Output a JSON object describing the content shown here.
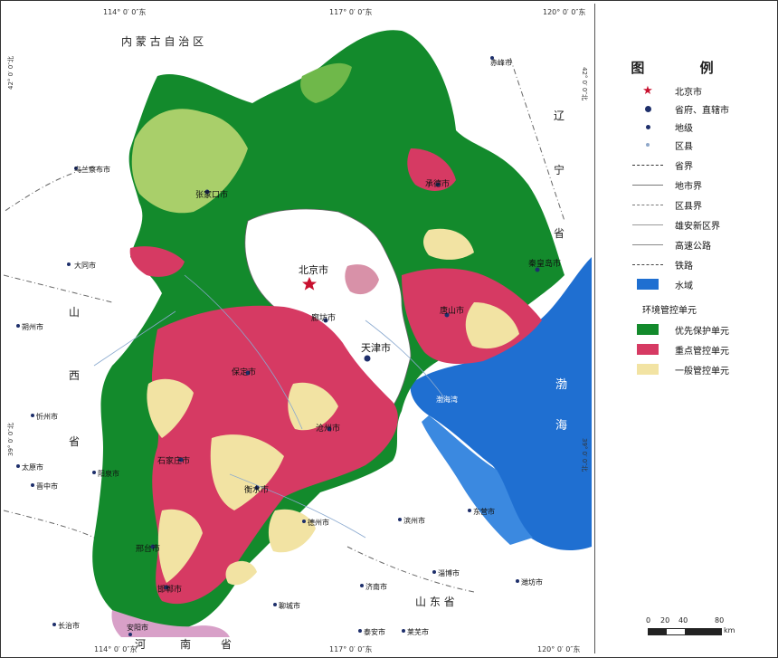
{
  "legend": {
    "title": "图  例",
    "items": [
      {
        "label": "北京市",
        "sym": "star",
        "color": "#c8102e"
      },
      {
        "label": "省府、直辖市",
        "sym": "dot-big",
        "color": "#1e2f6b"
      },
      {
        "label": "地级",
        "sym": "dot",
        "color": "#1e2f6b"
      },
      {
        "label": "区县",
        "sym": "dot-small",
        "color": "#8fa7c9"
      },
      {
        "label": "省界",
        "sym": "dashdot",
        "color": "#333333"
      },
      {
        "label": "地市界",
        "sym": "line-thin",
        "color": "#777777"
      },
      {
        "label": "区县界",
        "sym": "dashdot-thin",
        "color": "#777777"
      },
      {
        "label": "雄安新区界",
        "sym": "line-thin",
        "color": "#999999"
      },
      {
        "label": "高速公路",
        "sym": "line",
        "color": "#888888"
      },
      {
        "label": "铁路",
        "sym": "dashed",
        "color": "#444444"
      },
      {
        "label": "水域",
        "sym": "box",
        "color": "#1f6fd1"
      }
    ],
    "subtitle": "环境管控单元",
    "units": [
      {
        "label": "优先保护单元",
        "color": "#138a2c"
      },
      {
        "label": "重点管控单元",
        "color": "#d63a63"
      },
      {
        "label": "一般管控单元",
        "color": "#f2e3a3"
      }
    ],
    "scale": {
      "ticks": [
        "0",
        "20",
        "40",
        "80"
      ],
      "unit": "km"
    }
  },
  "map": {
    "graticule": {
      "top": [
        "114° 0′ 0″东",
        "117° 0′ 0″东",
        "120° 0′ 0″东"
      ],
      "bottom": [
        "114° 0′ 0″东",
        "117° 0′ 0″东",
        "120° 0′ 0″东"
      ],
      "left": [
        "42° 0′ 0″北",
        "39° 0′ 0″北"
      ],
      "right": [
        "42° 0′ 0″北",
        "39° 0′ 0″北"
      ]
    },
    "regions": [
      "内 蒙 古 自 治 区",
      "辽",
      "宁",
      "省",
      "山",
      "西",
      "省",
      "山  东  省",
      "河",
      "南",
      "省"
    ],
    "sea": {
      "bohai": [
        "渤",
        "海"
      ],
      "bay": "渤海湾"
    },
    "main_cities": [
      "北京市",
      "天津市"
    ],
    "hebei_cities": [
      "张家口市",
      "承德市",
      "秦皇岛市",
      "唐山市",
      "廊坊市",
      "保定市",
      "沧州市",
      "石家庄市",
      "衡水市",
      "邢台市",
      "邯郸市"
    ],
    "other_cities": [
      "乌兰察布市",
      "赤峰市",
      "大同市",
      "朔州市",
      "忻州市",
      "太原市",
      "阳泉市",
      "晋中市",
      "长治市",
      "安阳市",
      "德州市",
      "滨州市",
      "东营市",
      "淄博市",
      "潍坊市",
      "济南市",
      "聊城市",
      "泰安市",
      "莱芜市"
    ]
  }
}
